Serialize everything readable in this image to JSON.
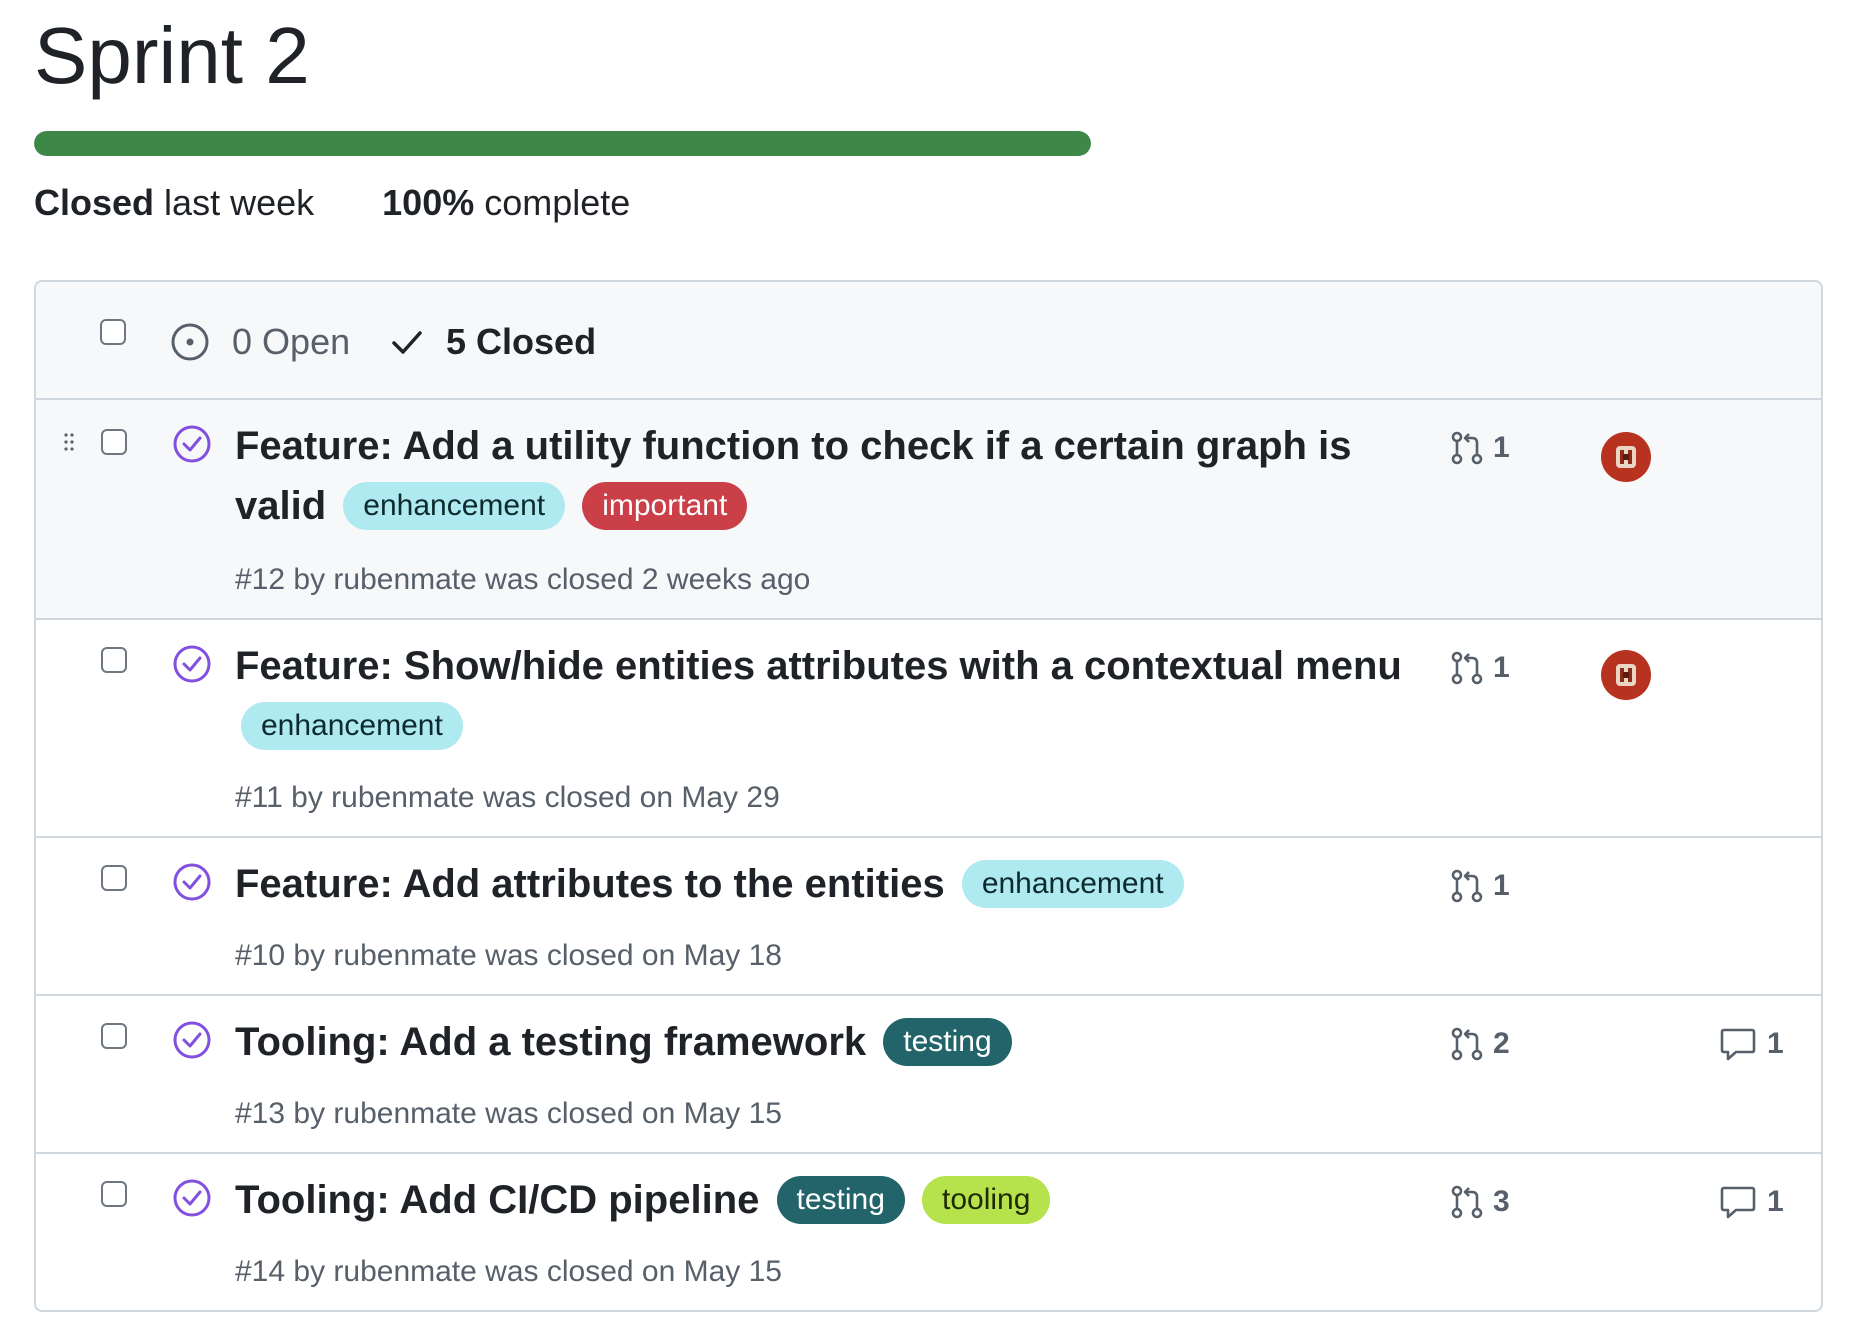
{
  "milestone": {
    "title": "Sprint 2",
    "progress": 1.0,
    "closed_label": "Closed",
    "closed_when": "last week",
    "percent_label": "100%",
    "complete_label": "complete",
    "progress_color": "#3d8747"
  },
  "filters": {
    "open_count": "0",
    "open_label": "Open",
    "closed_count": "5",
    "closed_label": "Closed"
  },
  "issues": [
    {
      "title": "Feature: Add a utility function to check if a certain graph is valid",
      "labels": [
        {
          "name": "enhancement",
          "color": "#aeeaf0"
        },
        {
          "name": "important",
          "color": "#cb3f48"
        }
      ],
      "meta": "#12 by rubenmate was closed 2 weeks ago",
      "pr_count": "1",
      "has_avatar": true,
      "comment_count": null
    },
    {
      "title": "Feature: Show/hide entities attributes with a contextual menu",
      "labels": [
        {
          "name": "enhancement",
          "color": "#aeeaf0"
        }
      ],
      "meta": "#11 by rubenmate was closed on May 29",
      "pr_count": "1",
      "has_avatar": true,
      "comment_count": null
    },
    {
      "title": "Feature: Add attributes to the entities",
      "labels": [
        {
          "name": "enhancement",
          "color": "#aeeaf0"
        }
      ],
      "meta": "#10 by rubenmate was closed on May 18",
      "pr_count": "1",
      "has_avatar": false,
      "comment_count": null
    },
    {
      "title": "Tooling: Add a testing framework",
      "labels": [
        {
          "name": "testing",
          "color": "#226469"
        }
      ],
      "meta": "#13 by rubenmate was closed on May 15",
      "pr_count": "2",
      "has_avatar": false,
      "comment_count": "1"
    },
    {
      "title": "Tooling: Add CI/CD pipeline",
      "labels": [
        {
          "name": "testing",
          "color": "#226469"
        },
        {
          "name": "tooling",
          "color": "#b6e34b"
        }
      ],
      "meta": "#14 by rubenmate was closed on May 15",
      "pr_count": "3",
      "has_avatar": false,
      "comment_count": "1"
    }
  ],
  "icons": {
    "open": "issue-opened-icon",
    "closed_filter": "check-icon",
    "closed_issue": "issue-closed-icon",
    "pull_request": "git-pull-request-icon",
    "comment": "comment-icon",
    "drag": "drag-handle-icon"
  }
}
